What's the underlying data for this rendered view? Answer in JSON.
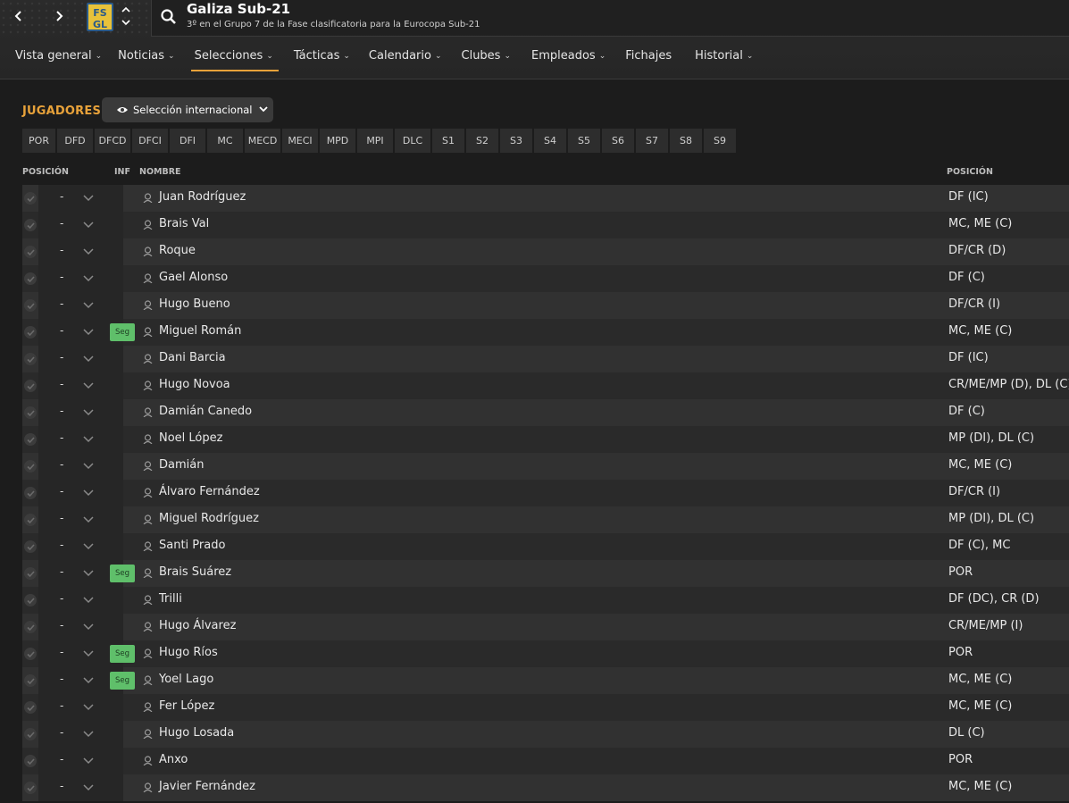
{
  "header": {
    "team_name": "Galiza Sub-21",
    "subtitle": "3º en el Grupo 7 de la Fase clasificatoria para la Eurocopa Sub-21",
    "logo_text": "FSGL"
  },
  "menu": [
    {
      "label": "Vista general",
      "chevron": true
    },
    {
      "label": "Noticias",
      "chevron": true
    },
    {
      "label": "Selecciones",
      "chevron": true,
      "active": true
    },
    {
      "label": "Tácticas",
      "chevron": true
    },
    {
      "label": "Calendario",
      "chevron": true
    },
    {
      "label": "Clubes",
      "chevron": true
    },
    {
      "label": "Empleados",
      "chevron": true
    },
    {
      "label": "Fichajes",
      "chevron": false
    },
    {
      "label": "Historial",
      "chevron": true
    }
  ],
  "section": {
    "title": "JUGADORES",
    "selector_label": "Selección internacional"
  },
  "position_filters": [
    "POR",
    "DFD",
    "DFCD",
    "DFCI",
    "DFI",
    "MC",
    "MECD",
    "MECI",
    "MPD",
    "MPI",
    "DLC",
    "S1",
    "S2",
    "S3",
    "S4",
    "S5",
    "S6",
    "S7",
    "S8",
    "S9"
  ],
  "table": {
    "headers": {
      "position_left": "POSICIÓN",
      "inf": "INF",
      "name": "NOMBRE",
      "position_right": "POSICIÓN"
    },
    "rows": [
      {
        "slot": "-",
        "inf": "",
        "name": "Juan Rodríguez",
        "position": "DF (IC)"
      },
      {
        "slot": "-",
        "inf": "",
        "name": "Brais Val",
        "position": "MC, ME (C)"
      },
      {
        "slot": "-",
        "inf": "",
        "name": "Roque",
        "position": "DF/CR (D)"
      },
      {
        "slot": "-",
        "inf": "",
        "name": "Gael Alonso",
        "position": "DF (C)"
      },
      {
        "slot": "-",
        "inf": "",
        "name": "Hugo Bueno",
        "position": "DF/CR (I)"
      },
      {
        "slot": "-",
        "inf": "Seg",
        "name": "Miguel Román",
        "position": "MC, ME (C)"
      },
      {
        "slot": "-",
        "inf": "",
        "name": "Dani Barcia",
        "position": "DF (IC)"
      },
      {
        "slot": "-",
        "inf": "",
        "name": "Hugo Novoa",
        "position": "CR/ME/MP (D), DL (C)"
      },
      {
        "slot": "-",
        "inf": "",
        "name": "Damián Canedo",
        "position": "DF (C)"
      },
      {
        "slot": "-",
        "inf": "",
        "name": "Noel López",
        "position": "MP (DI), DL (C)"
      },
      {
        "slot": "-",
        "inf": "",
        "name": "Damián",
        "position": "MC, ME (C)"
      },
      {
        "slot": "-",
        "inf": "",
        "name": "Álvaro Fernández",
        "position": "DF/CR (I)"
      },
      {
        "slot": "-",
        "inf": "",
        "name": "Miguel Rodríguez",
        "position": "MP (DI), DL (C)"
      },
      {
        "slot": "-",
        "inf": "",
        "name": "Santi Prado",
        "position": "DF (C), MC"
      },
      {
        "slot": "-",
        "inf": "Seg",
        "name": "Brais Suárez",
        "position": "POR"
      },
      {
        "slot": "-",
        "inf": "",
        "name": "Trilli",
        "position": "DF (DC), CR (D)"
      },
      {
        "slot": "-",
        "inf": "",
        "name": "Hugo Álvarez",
        "position": "CR/ME/MP (I)"
      },
      {
        "slot": "-",
        "inf": "Seg",
        "name": "Hugo Ríos",
        "position": "POR"
      },
      {
        "slot": "-",
        "inf": "Seg",
        "name": "Yoel Lago",
        "position": "MC, ME (C)"
      },
      {
        "slot": "-",
        "inf": "",
        "name": "Fer López",
        "position": "MC, ME (C)"
      },
      {
        "slot": "-",
        "inf": "",
        "name": "Hugo Losada",
        "position": "DL (C)"
      },
      {
        "slot": "-",
        "inf": "",
        "name": "Anxo",
        "position": "POR"
      },
      {
        "slot": "-",
        "inf": "",
        "name": "Javier Fernández",
        "position": "MC, ME (C)"
      }
    ]
  },
  "colors": {
    "accent": "#e8a23a",
    "seg_badge": "#5fbf6a"
  }
}
